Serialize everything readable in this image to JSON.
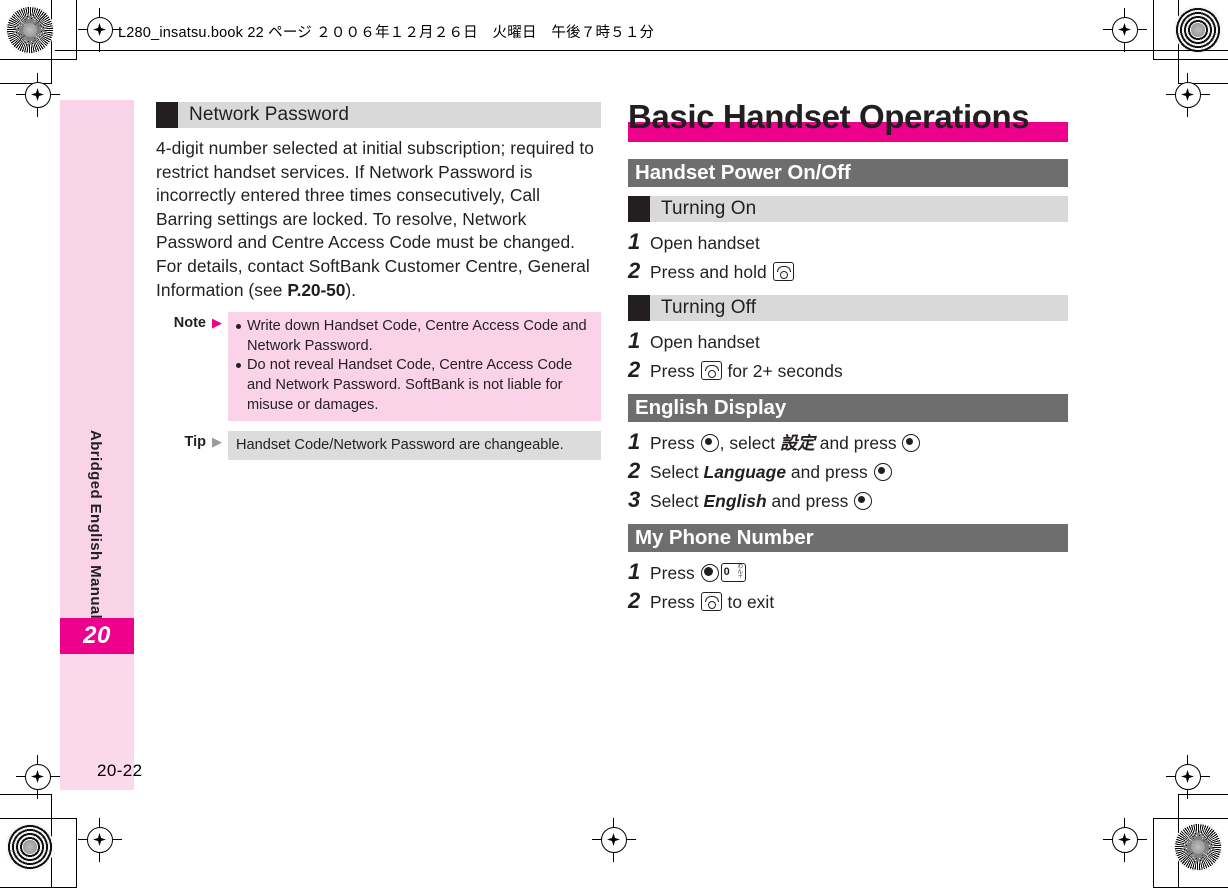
{
  "meta": {
    "running_header": "L280_insatsu.book  22 ページ  ２００６年１２月２６日　火曜日　午後７時５１分",
    "page_number": "20-22",
    "side_tab_number": "20",
    "side_label": "Abridged English Manual",
    "accent_magenta": "#ec008c",
    "band_gray": "#6e6e6e",
    "subband_gray": "#d9d9d9",
    "note_pink": "#fbd3e8",
    "tip_gray": "#dcdcdc"
  },
  "left_column": {
    "subheading": "Network Password",
    "body": "4-digit number selected at initial subscription; required to restrict handset services. If Network Password is incorrectly entered three times consecutively, Call Barring settings are locked. To resolve, Network Password and Centre Access Code must be changed. For details, contact SoftBank Customer Centre, General Information (see ",
    "body_ref": "P.20-50",
    "body_tail": ").",
    "note": {
      "label": "Note",
      "arrow": "▶",
      "bullets": [
        "Write down Handset Code, Centre Access Code and Network Password.",
        "Do not reveal Handset Code, Centre Access Code and Network Password. SoftBank is not liable for misuse or damages."
      ]
    },
    "tip": {
      "label": "Tip",
      "arrow": "▶",
      "text": "Handset Code/Network Password are changeable."
    }
  },
  "right_column": {
    "title": "Basic Handset Operations",
    "sections": [
      {
        "heading": "Handset Power On/Off",
        "type": "section",
        "subsections": [
          {
            "subheading": "Turning On",
            "steps": [
              {
                "n": "1",
                "pre": "Open handset",
                "icon": "",
                "post": ""
              },
              {
                "n": "2",
                "pre": "Press and hold ",
                "icon": "power-key",
                "post": ""
              }
            ]
          },
          {
            "subheading": "Turning Off",
            "steps": [
              {
                "n": "1",
                "pre": "Open handset",
                "icon": "",
                "post": ""
              },
              {
                "n": "2",
                "pre": "Press ",
                "icon": "power-key",
                "post": " for 2+ seconds"
              }
            ]
          }
        ]
      },
      {
        "heading": "English Display",
        "type": "section",
        "steps": [
          {
            "n": "1",
            "parts": [
              "Press ",
              "center-key",
              ", select ",
              "設定",
              " and press ",
              "center-key"
            ]
          },
          {
            "n": "2",
            "parts": [
              "Select ",
              "Language",
              " and press ",
              "center-key"
            ]
          },
          {
            "n": "3",
            "parts": [
              "Select ",
              "English",
              " and press ",
              "center-key"
            ]
          }
        ]
      },
      {
        "heading": "My Phone Number",
        "type": "section",
        "steps": [
          {
            "n": "1",
            "pre": "Press ",
            "icon": "center-key-solid-zero",
            "post": ""
          },
          {
            "n": "2",
            "pre": "Press ",
            "icon": "power-key",
            "post": " to exit"
          }
        ]
      }
    ],
    "keys": {
      "zero_digit": "0",
      "zero_marks_1": "わ",
      "zero_marks_2": "ん",
      "zero_marks_3": "＋"
    },
    "english_steps_text": {
      "s1_a": "Press ",
      "s1_b": ", select ",
      "s1_jp": "設定",
      "s1_c": " and press ",
      "s2_a": "Select ",
      "s2_it": "Language",
      "s2_b": " and press ",
      "s3_a": "Select ",
      "s3_it": "English",
      "s3_b": " and press "
    }
  }
}
